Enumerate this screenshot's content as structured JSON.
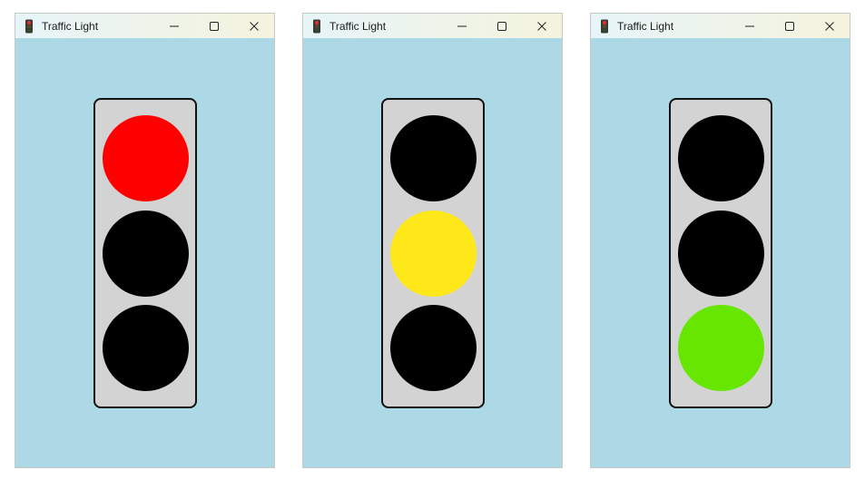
{
  "windows": [
    {
      "title": "Traffic Light",
      "active_light": 0,
      "lights": [
        {
          "name": "red",
          "on": true
        },
        {
          "name": "yellow",
          "on": false
        },
        {
          "name": "green",
          "on": false
        }
      ]
    },
    {
      "title": "Traffic Light",
      "active_light": 1,
      "lights": [
        {
          "name": "red",
          "on": false
        },
        {
          "name": "yellow",
          "on": true
        },
        {
          "name": "green",
          "on": false
        }
      ]
    },
    {
      "title": "Traffic Light",
      "active_light": 2,
      "lights": [
        {
          "name": "red",
          "on": false
        },
        {
          "name": "yellow",
          "on": false
        },
        {
          "name": "green",
          "on": true
        }
      ]
    }
  ],
  "colors": {
    "client_background": "#add8e6",
    "housing_fill": "#d3d3d3",
    "housing_border": "#111111",
    "light_off": "#000000",
    "red_on": "#ff0000",
    "yellow_on": "#ffe81a",
    "green_on": "#66e600",
    "titlebar_gradient": [
      "#e7f5f8",
      "#f5f3de"
    ]
  },
  "icons": {
    "app": "traffic-light-icon",
    "minimize": "minimize-icon",
    "maximize": "maximize-icon",
    "close": "close-icon"
  }
}
